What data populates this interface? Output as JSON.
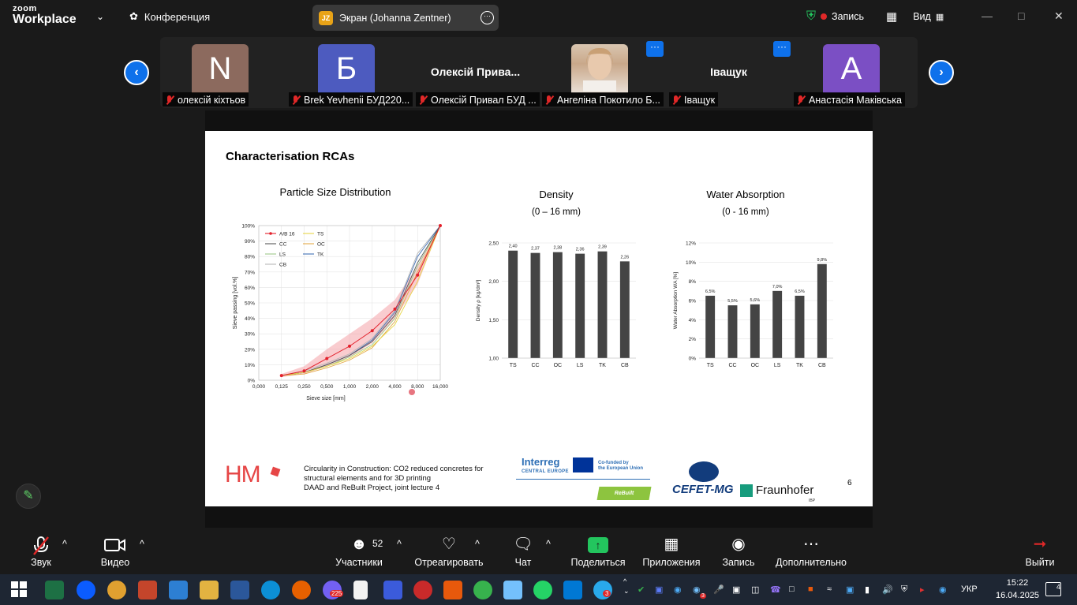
{
  "app": {
    "logo_line1": "zoom",
    "logo_line2": "Workplace",
    "meeting_label": "Конференция",
    "screen_share_initials": "JZ",
    "screen_share_label": "Экран (Johanna Zentner)",
    "record_label": "Запись",
    "view_label": "Вид"
  },
  "participants": [
    {
      "initial": "N",
      "label": "олексій кіхтьов",
      "avatar_color": "#8c6a5e"
    },
    {
      "initial": "Б",
      "label": "Brek Yevhenii БУД220...",
      "avatar_color": "#4d5bbf"
    },
    {
      "big_name": "Олексій  Прива...",
      "label": "Олексій Привал БУД ..."
    },
    {
      "photo": true,
      "label": "Ангеліна Покотило Б..."
    },
    {
      "big_name": "Іващук",
      "label": "Іващук"
    },
    {
      "initial": "А",
      "label": "Анастасія Маківська",
      "avatar_color": "#7b4fc4"
    }
  ],
  "slide": {
    "title": "Characterisation RCAs",
    "footer_lines": [
      "Circularity in Construction: CO2 reduced concretes for",
      "structural elements and for 3D printing",
      "DAAD and ReBuilt Project, joint lecture 4"
    ],
    "page_number": "6",
    "logos": {
      "hm": "HM",
      "interreg": "Interreg",
      "interreg_sub": "CENTRAL EUROPE",
      "eu_line1": "Co-funded by",
      "eu_line2": "the European Union",
      "rebuilt": "ReBuilt",
      "cefet": "CEFET-MG",
      "fraunhofer": "Fraunhofer",
      "ibp": "IBP"
    }
  },
  "chart_data": [
    {
      "type": "line",
      "title": "Particle Size Distribution",
      "xlabel": "Sieve size [mm]",
      "ylabel": "Sieve passing [vol.%]",
      "categories": [
        "0,000",
        "0,125",
        "0,250",
        "0,500",
        "1,000",
        "2,000",
        "4,000",
        "8,000",
        "16,000"
      ],
      "y_ticks": [
        "0%",
        "10%",
        "20%",
        "30%",
        "40%",
        "50%",
        "60%",
        "70%",
        "80%",
        "90%",
        "100%"
      ],
      "ylim": [
        0,
        100
      ],
      "legend": "top-left",
      "series": [
        {
          "name": "A/B 16",
          "color": "#e3202b",
          "values": [
            null,
            3,
            6,
            14,
            22,
            32,
            46,
            68,
            100
          ]
        },
        {
          "name": "TS",
          "color": "#e6d648",
          "values": [
            null,
            3,
            5,
            9,
            14,
            22,
            36,
            64,
            100
          ]
        },
        {
          "name": "CC",
          "color": "#555555",
          "values": [
            null,
            3,
            5,
            10,
            16,
            25,
            42,
            76,
            100
          ]
        },
        {
          "name": "OC",
          "color": "#e3a848",
          "values": [
            null,
            3,
            4,
            8,
            13,
            21,
            38,
            70,
            100
          ]
        },
        {
          "name": "LS",
          "color": "#9fc88a",
          "values": [
            null,
            3,
            5,
            9,
            15,
            23,
            40,
            74,
            100
          ]
        },
        {
          "name": "TK",
          "color": "#3f6fb5",
          "values": [
            null,
            3,
            5,
            10,
            16,
            26,
            44,
            80,
            100
          ]
        },
        {
          "name": "CB",
          "color": "#b7b7b7",
          "values": [
            null,
            3,
            6,
            11,
            17,
            27,
            45,
            82,
            100
          ]
        }
      ],
      "band": {
        "lower": [
          null,
          2,
          4,
          9,
          15,
          24,
          40,
          62,
          100
        ],
        "upper": [
          null,
          4,
          9,
          20,
          30,
          40,
          52,
          74,
          100
        ]
      }
    },
    {
      "type": "bar",
      "title": "Density",
      "subtitle": "(0 – 16 mm)",
      "ylabel": "Density ρ [kg/dm³]",
      "categories": [
        "TS",
        "CC",
        "OC",
        "LS",
        "TK",
        "CB"
      ],
      "values": [
        2.4,
        2.37,
        2.38,
        2.36,
        2.39,
        2.26
      ],
      "data_labels": [
        "2,40",
        "2,37",
        "2,38",
        "2,36",
        "2,39",
        "2,26"
      ],
      "y_ticks": [
        "1,00",
        "1,50",
        "2,00",
        "2,50"
      ],
      "ylim": [
        1.0,
        2.5
      ],
      "color": "#444444"
    },
    {
      "type": "bar",
      "title": "Water Absorption",
      "subtitle": "(0 - 16 mm)",
      "ylabel": "Water Absorption WA [%]",
      "categories": [
        "TS",
        "CC",
        "OC",
        "LS",
        "TK",
        "CB"
      ],
      "values": [
        6.5,
        5.5,
        5.6,
        7.0,
        6.5,
        9.8
      ],
      "data_labels": [
        "6,5%",
        "5,5%",
        "5,6%",
        "7,0%",
        "6,5%",
        "9,8%"
      ],
      "y_ticks": [
        "0%",
        "2%",
        "4%",
        "6%",
        "8%",
        "10%",
        "12%"
      ],
      "ylim": [
        0,
        12
      ],
      "color": "#444444"
    }
  ],
  "toolbar": {
    "audio": "Звук",
    "video": "Видео",
    "participants": "Участники",
    "participants_count": "52",
    "react": "Отреагировать",
    "chat": "Чат",
    "share": "Поделиться",
    "apps": "Приложения",
    "record": "Запись",
    "more": "Дополнительно",
    "leave": "Выйти"
  },
  "taskbar": {
    "keyboard": "УКР",
    "time": "15:22",
    "date": "16.04.2025",
    "viber_badge": "225",
    "telegram_badge": "3",
    "teams_badge": "3",
    "notifications": "4"
  }
}
